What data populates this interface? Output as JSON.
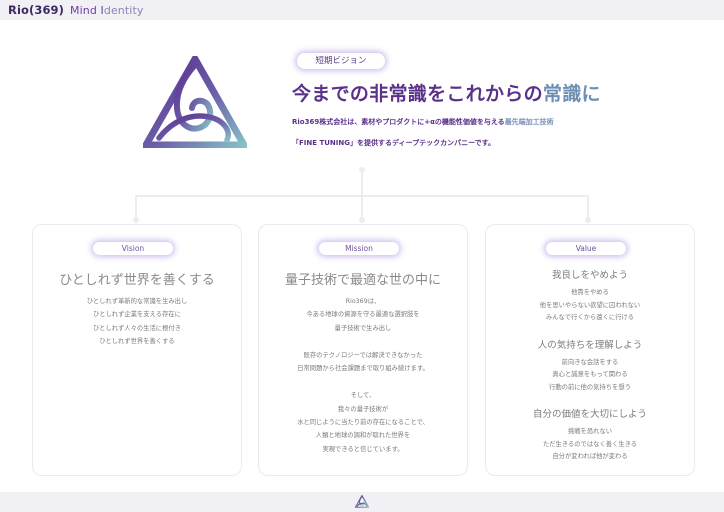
{
  "header": {
    "brand": "Rio(369)",
    "sub_part1": "Mind I",
    "sub_part2": "dentity"
  },
  "hero": {
    "badge": "短期ビジョン",
    "title_part1": "今までの非常識をこれからの",
    "title_part2": "常識に",
    "desc_part1": "Rio369株式会社は、素材やプロダクトに+αの機能性価値を与える",
    "desc_part2": "最先端加工技術",
    "desc_line2": "「FINE TUNING」を提供するディープテックカンパニーです。"
  },
  "cards": {
    "vision": {
      "badge": "Vision",
      "title": "ひとしれず世界を善くする",
      "lines": [
        "ひとしれず革新的な常識を生み出し",
        "ひとしれず企業を支える存在に",
        "ひとしれず人々の生活に根付き",
        "ひとしれず世界を善くする"
      ]
    },
    "mission": {
      "badge": "Mission",
      "title": "量子技術で最適な世の中に",
      "p1": [
        "Rio369は、",
        "今ある地球の資源を守る最適な選択肢を",
        "量子技術で生み出し"
      ],
      "p2": [
        "既存のテクノロジーでは解決できなかった",
        "日常問題から社会課題まで取り組み続けます。"
      ],
      "p3": [
        "そして、",
        "我々の量子技術が",
        "水と同じように当たり前の存在になることで、",
        "人類と地球の調和が取れた世界を",
        "実現できると信じています。"
      ]
    },
    "value": {
      "badge": "Value",
      "s1_title": "我良しをやめよう",
      "s1_lines": [
        "他責をやめる",
        "他を思いやらない欲望に囚われない",
        "みんなで行くから遠くに行ける"
      ],
      "s2_title": "人の気持ちを理解しよう",
      "s2_lines": [
        "前向きな会話をする",
        "真心と誠意をもって関わる",
        "行動の前に他の気持ちを想う"
      ],
      "s3_title": "自分の価値を大切にしよう",
      "s3_lines": [
        "挑戦を恐れない",
        "ただ生きるのではなく善く生きる",
        "自分が変われば他が変わる"
      ]
    }
  }
}
